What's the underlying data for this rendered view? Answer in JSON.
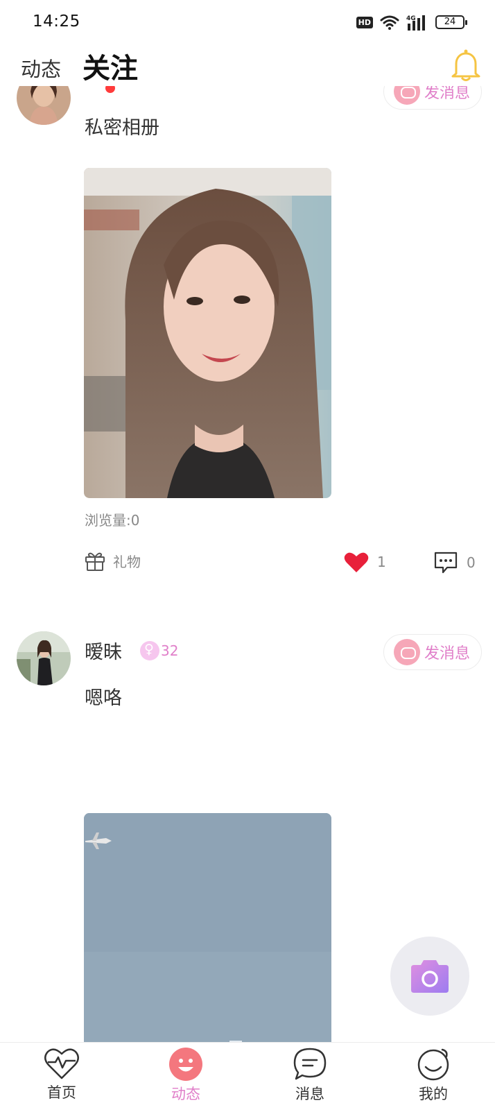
{
  "status_bar": {
    "time": "14:25",
    "hd": "HD",
    "network": "4G",
    "battery": "24",
    "icons": [
      "hd-icon",
      "wifi-icon",
      "signal-icon",
      "battery-icon"
    ]
  },
  "header": {
    "tab_dynamic": "动态",
    "tab_follow": "关注",
    "bell_icon": "bell-icon",
    "bell_color": "#f5c443"
  },
  "posts": [
    {
      "username": "",
      "message_button": "发消息",
      "text": "私密相册",
      "views": "浏览量:0",
      "gift_label": "礼物",
      "like_count": "1",
      "comment_count": "0",
      "liked": true
    },
    {
      "username": "暧昧",
      "level": "32",
      "message_button": "发消息",
      "text": "嗯咯"
    }
  ],
  "fab": {
    "icon": "camera-icon",
    "color": "#c98bf0"
  },
  "bottom_nav": {
    "items": [
      {
        "label": "首页",
        "icon": "heart-pulse-icon",
        "active": false
      },
      {
        "label": "动态",
        "icon": "smile-face-icon",
        "active": true
      },
      {
        "label": "消息",
        "icon": "chat-bubble-icon",
        "active": false
      },
      {
        "label": "我的",
        "icon": "profile-face-icon",
        "active": false
      }
    ]
  },
  "colors": {
    "accent": "#e07fc9",
    "like_red": "#e8203a",
    "nav_active": "#f4777e"
  }
}
